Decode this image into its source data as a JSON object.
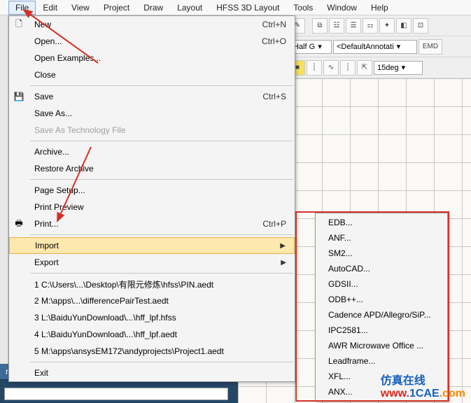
{
  "menubar": {
    "items": [
      "File",
      "Edit",
      "View",
      "Project",
      "Draw",
      "Layout",
      "HFSS 3D Layout",
      "Tools",
      "Window",
      "Help"
    ],
    "active_index": 0
  },
  "toolbar": {
    "dropdown1": "Half G",
    "dropdown2": "<DefaultAnnotati",
    "btn_emd": "EMD",
    "angle": "15deg"
  },
  "file_menu": {
    "new": {
      "label": "New",
      "shortcut": "Ctrl+N"
    },
    "open": {
      "label": "Open...",
      "shortcut": "Ctrl+O"
    },
    "open_examples": {
      "label": "Open Examples..."
    },
    "close": {
      "label": "Close"
    },
    "save": {
      "label": "Save",
      "shortcut": "Ctrl+S"
    },
    "save_as": {
      "label": "Save As..."
    },
    "save_as_tech": {
      "label": "Save As Technology File"
    },
    "archive": {
      "label": "Archive..."
    },
    "restore_archive": {
      "label": "Restore Archive"
    },
    "page_setup": {
      "label": "Page Setup..."
    },
    "print_preview": {
      "label": "Print Preview"
    },
    "print": {
      "label": "Print...",
      "shortcut": "Ctrl+P"
    },
    "import": {
      "label": "Import"
    },
    "export": {
      "label": "Export"
    },
    "recent": [
      "1 C:\\Users\\...\\Desktop\\有限元修炼\\hfss\\PIN.aedt",
      "2 M:\\apps\\...\\differencePairTest.aedt",
      "3 L:\\BaiduYunDownload\\...\\hff_lpf.hfss",
      "4 L:\\BaiduYunDownload\\...\\hff_lpf.aedt",
      "5 M:\\apps\\ansysEM172\\andyprojects\\Project1.aedt"
    ],
    "exit": {
      "label": "Exit"
    }
  },
  "import_submenu": [
    "EDB...",
    "ANF...",
    "SM2...",
    "AutoCAD...",
    "GDSII...",
    "ODB++...",
    "Cadence APD/Allegro/SiP...",
    "IPC2581...",
    "AWR Microwave Office ...",
    "Leadframe...",
    "XFL...",
    "ANX..."
  ],
  "properties_panel": {
    "title": "roperties"
  },
  "watermark": {
    "faint": "1CAE.COM",
    "cn": "仿真在线",
    "url1": "www.",
    "url2": "1CAE",
    "url3": ".com"
  }
}
